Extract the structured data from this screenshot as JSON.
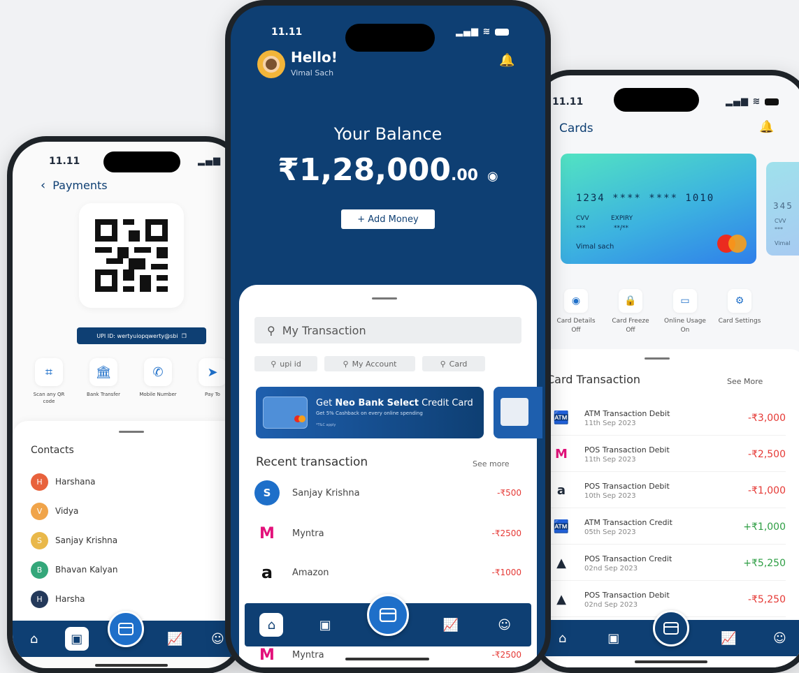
{
  "status": {
    "time": "11.11"
  },
  "payments": {
    "title": "Payments",
    "upi_id": "UPI ID: wertyuiopqwerty@sbi",
    "actions": [
      {
        "label": "Scan any QR code",
        "icon": "scan-icon"
      },
      {
        "label": "Bank Transfer",
        "icon": "bank-icon"
      },
      {
        "label": "Mobile Number",
        "icon": "phone-icon"
      },
      {
        "label": "Pay To",
        "icon": "send-icon"
      }
    ],
    "contacts_title": "Contacts",
    "contacts": [
      {
        "initial": "H",
        "name": "Harshana",
        "color": "#e8623c"
      },
      {
        "initial": "V",
        "name": "Vidya",
        "color": "#f0a44a"
      },
      {
        "initial": "S",
        "name": "Sanjay Krishna",
        "color": "#e9b84a"
      },
      {
        "initial": "B",
        "name": "Bhavan Kalyan",
        "color": "#34a77a"
      },
      {
        "initial": "H",
        "name": "Harsha",
        "color": "#24395a"
      }
    ]
  },
  "home": {
    "greeting": "Hello!",
    "user_name": "Vimal Sach",
    "balance_label": "Your Balance",
    "balance_main": "₹1,28,000",
    "balance_decimal": ".00",
    "add_money": "+ Add Money",
    "search_placeholder": "My Transaction",
    "chips": [
      "upi id",
      "My Account",
      "Card"
    ],
    "promo_title_prefix": "Get ",
    "promo_title_brand": "Neo Bank Select",
    "promo_title_suffix": " Credit Card",
    "promo_subtitle": "Get 5% Cashback on every online spending",
    "promo_note": "*T&C apply",
    "recent_title": "Recent transaction",
    "see_more": "See more",
    "transactions": [
      {
        "name": "Sanjay Krishna",
        "amount": "-₹500",
        "logo": "S"
      },
      {
        "name": "Myntra",
        "amount": "-₹2500",
        "logo": "M"
      },
      {
        "name": "Amazon",
        "amount": "-₹1000",
        "logo": "a"
      },
      {
        "name": "Myntra",
        "amount": "-₹2500",
        "logo": "M"
      }
    ]
  },
  "cards": {
    "title": "Cards",
    "card_number": "1234 **** **** 1010",
    "card2_number": "345",
    "cvv_label": "CVV",
    "cvv_value": "***",
    "expiry_label": "EXPIRY",
    "expiry_value": "**/**",
    "card_holder": "Vimal sach",
    "card2_cvv": "CVV",
    "card2_cvv_value": "***",
    "card2_holder": "Vimal",
    "actions": [
      {
        "label": "Card Details Off",
        "icon": "eye-icon"
      },
      {
        "label": "Card Freeze Off",
        "icon": "lock-icon"
      },
      {
        "label": "Online Usage On",
        "icon": "online-icon"
      },
      {
        "label": "Card Settings",
        "icon": "gear-icon"
      }
    ],
    "section_title": "Card Transaction",
    "see_more": "See More",
    "transactions": [
      {
        "title": "ATM Transaction Debit",
        "date": "11th Sep 2023",
        "amount": "-₹3,000",
        "type": "neg",
        "icon": "atm"
      },
      {
        "title": "POS Transaction Debit",
        "date": "11th Sep 2023",
        "amount": "-₹2,500",
        "type": "neg",
        "icon": "myntra"
      },
      {
        "title": "POS Transaction Debit",
        "date": "10th Sep 2023",
        "amount": "-₹1,000",
        "type": "neg",
        "icon": "amazon"
      },
      {
        "title": "ATM Transaction Credit",
        "date": "05th Sep 2023",
        "amount": "+₹1,000",
        "type": "pos",
        "icon": "atm"
      },
      {
        "title": "POS Transaction Credit",
        "date": "02nd Sep 2023",
        "amount": "+₹5,250",
        "type": "pos",
        "icon": "adidas"
      },
      {
        "title": "POS Transaction Debit",
        "date": "02nd Sep 2023",
        "amount": "-₹5,250",
        "type": "neg",
        "icon": "adidas"
      }
    ]
  }
}
